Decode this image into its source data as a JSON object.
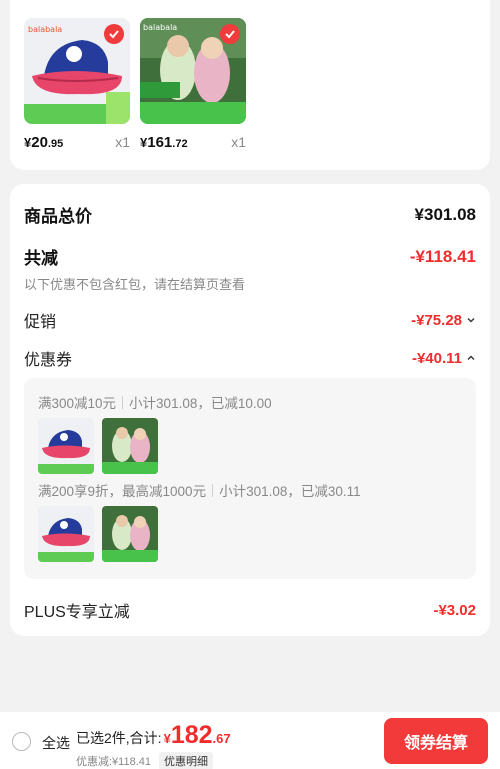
{
  "products": [
    {
      "brand": "balabala",
      "price_yen": "¥",
      "price_int": "20",
      "price_dec": ".95",
      "qty": "x1",
      "selected": true
    },
    {
      "brand": "balabala",
      "price_yen": "¥",
      "price_int": "161",
      "price_dec": ".72",
      "qty": "x1",
      "selected": true
    }
  ],
  "summary": {
    "goods_total_label": "商品总价",
    "goods_total_value": "¥301.08",
    "total_discount_label": "共减",
    "total_discount_value": "-¥118.41",
    "discount_note": "以下优惠不包含红包，请在结算页查看",
    "promo_label": "促销",
    "promo_value": "-¥75.28",
    "coupon_label": "优惠券",
    "coupon_value": "-¥40.11",
    "plus_label": "PLUS专享立减",
    "plus_value": "-¥3.02"
  },
  "coupons": [
    {
      "rule": "满300减10元",
      "detail": "小计301.08，已减10.00"
    },
    {
      "rule": "满200享9折，最高减1000元",
      "detail": "小计301.08，已减30.11"
    }
  ],
  "bottom": {
    "select_all": "全选",
    "selected_text": "已选2件,合计:",
    "total_yen": "¥",
    "total_int": "182",
    "total_dec": ".67",
    "discount_text": "优惠减:¥118.41",
    "detail_label": "优惠明细",
    "checkout_label": "领券结算"
  },
  "colors": {
    "accent": "#ef2d2d",
    "checkout_bg": "#f23a3a"
  }
}
